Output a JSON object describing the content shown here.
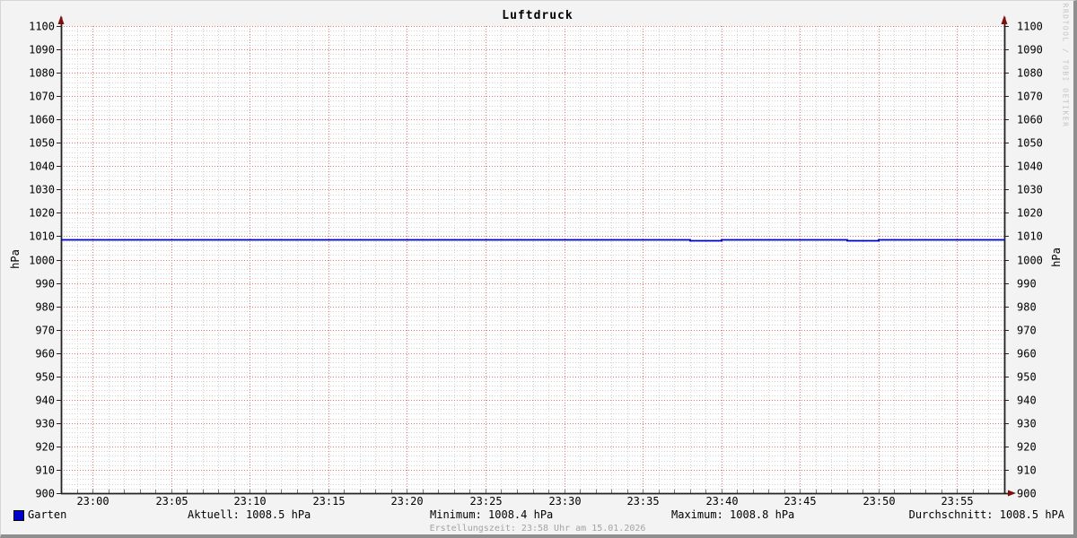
{
  "title": "Luftdruck",
  "chart_data": {
    "type": "line",
    "title": "Luftdruck",
    "ylabel_left": "hPa",
    "ylabel_right": "hPa",
    "ylim": [
      900,
      1100
    ],
    "ytick_step": 10,
    "yminor_step": 2,
    "xlim_minutes": [
      -2,
      58
    ],
    "xminor_step": 1,
    "x_ticks": [
      {
        "t": 0,
        "label": "23:00"
      },
      {
        "t": 5,
        "label": "23:05"
      },
      {
        "t": 10,
        "label": "23:10"
      },
      {
        "t": 15,
        "label": "23:15"
      },
      {
        "t": 20,
        "label": "23:20"
      },
      {
        "t": 25,
        "label": "23:25"
      },
      {
        "t": 30,
        "label": "23:30"
      },
      {
        "t": 35,
        "label": "23:35"
      },
      {
        "t": 40,
        "label": "23:40"
      },
      {
        "t": 45,
        "label": "23:45"
      },
      {
        "t": 50,
        "label": "23:50"
      },
      {
        "t": 55,
        "label": "23:55"
      }
    ],
    "series": [
      {
        "name": "Garten",
        "color": "#0000cc",
        "points": [
          [
            -2,
            1008.5
          ],
          [
            38,
            1008.5
          ],
          [
            38,
            1008.4
          ],
          [
            40,
            1008.4
          ],
          [
            40,
            1008.5
          ],
          [
            48,
            1008.5
          ],
          [
            48,
            1008.4
          ],
          [
            50,
            1008.4
          ],
          [
            50,
            1008.5
          ],
          [
            58,
            1008.5
          ]
        ]
      }
    ],
    "grid": {
      "plot_background": "#ffffff",
      "canvas_background": "#f3f3f3",
      "major_color": "#e87474",
      "minor_color": "#d4d4d4",
      "axis_color": "#222222",
      "arrow_color": "#7f0f0f",
      "legend_on": true,
      "legend_position": "bottom"
    }
  },
  "legend": {
    "series_label": "Garten",
    "swatch_color": "#0000cc",
    "aktuell": "Aktuell: 1008.5 hPa",
    "minimum": "Minimum: 1008.4 hPa",
    "maximum": "Maximum: 1008.8 hPa",
    "durchschnitt": "Durchschnitt: 1008.5 hPA"
  },
  "footer": "Erstellungszeit: 23:58 Uhr am 15.01.2026",
  "watermark": "RRDTOOL / TOBI OETIKER"
}
